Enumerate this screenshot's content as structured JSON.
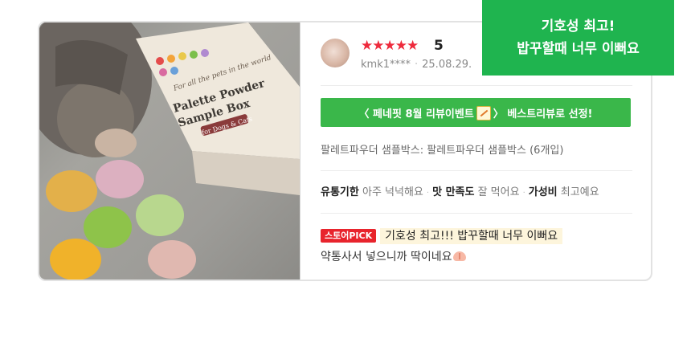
{
  "callout": {
    "line1": "기호성 최고!",
    "line2": "밥꾸할때 너무 이뻐요"
  },
  "photo": {
    "box_text_script": "For all the pets in the world",
    "box_title_1": "Palette Powder",
    "box_title_2": "Sample Box",
    "box_subtitle": "for Dogs & Cats"
  },
  "review": {
    "stars": "★★★★★",
    "rating": "5",
    "user": "kmk1****",
    "date": "25.08.29.",
    "event_text": "〈 페네핏 8월 리뷰이벤트",
    "event_text_2": "〉 베스트리뷰로 선정!",
    "product": "팔레트파우더 샘플박스: 팔레트파우더 샘플박스 (6개입)",
    "attrs": [
      {
        "key": "유통기한",
        "value": "아주 넉넉해요"
      },
      {
        "key": "맛 만족도",
        "value": "잘 먹어요"
      },
      {
        "key": "가성비",
        "value": "최고예요"
      }
    ],
    "badge": "스토어PICK",
    "highlight": "기호성 최고!!! 밥꾸할때 너무 이뻐요",
    "line2": "약통사서 넣으니까 딱이네요"
  },
  "colors": {
    "accent_green": "#3ab74a",
    "callout_green": "#1fb44f",
    "star_red": "#ee2a3c",
    "badge_red": "#e8242d",
    "highlight_bg": "#fdf5dc"
  }
}
